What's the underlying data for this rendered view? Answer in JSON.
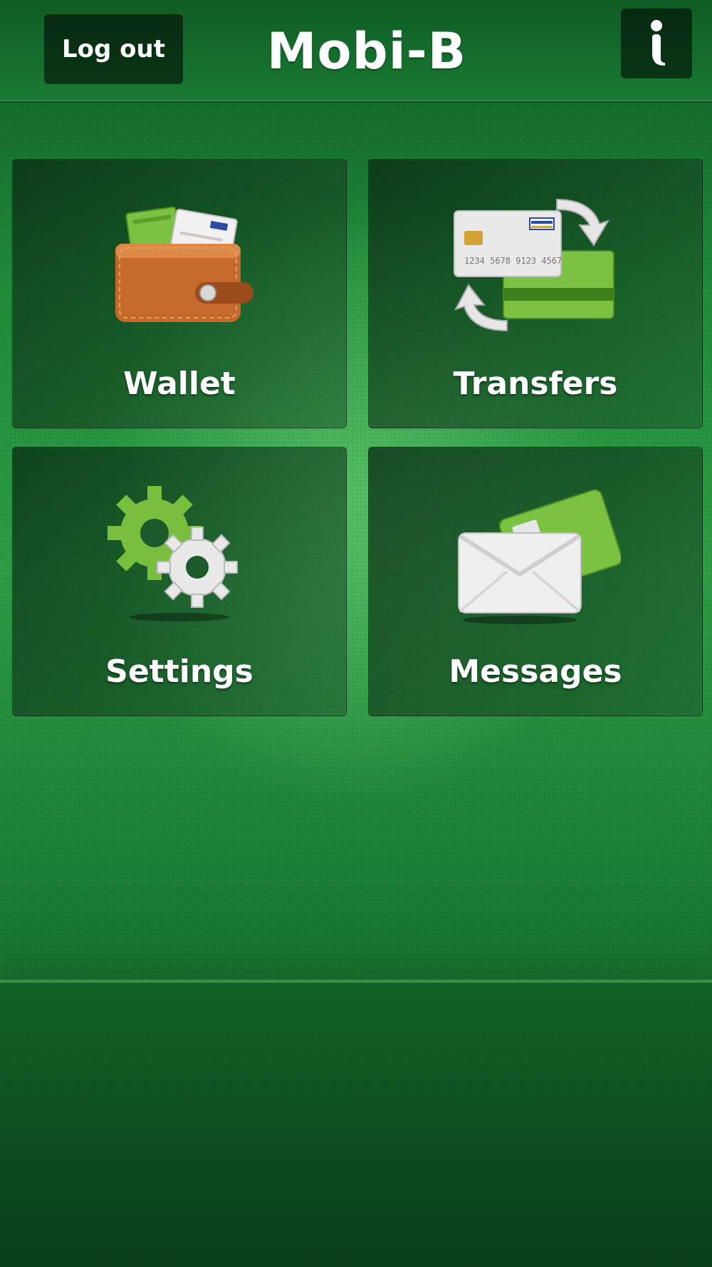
{
  "header": {
    "logout_label": "Log out",
    "title": "Mobi-B",
    "info_label": "i"
  },
  "tiles": [
    {
      "label": "Wallet",
      "icon": "wallet-icon"
    },
    {
      "label": "Transfers",
      "icon": "card-transfer-icon"
    },
    {
      "label": "Settings",
      "icon": "gears-icon"
    },
    {
      "label": "Messages",
      "icon": "envelope-icon"
    }
  ],
  "transfers_card": {
    "number": "1234 5678 9123 4567",
    "brand": "VISA"
  },
  "colors": {
    "accent_green": "#7ac143",
    "background_dark": "#0f5b25",
    "tile_bg": "#0a2d14"
  }
}
